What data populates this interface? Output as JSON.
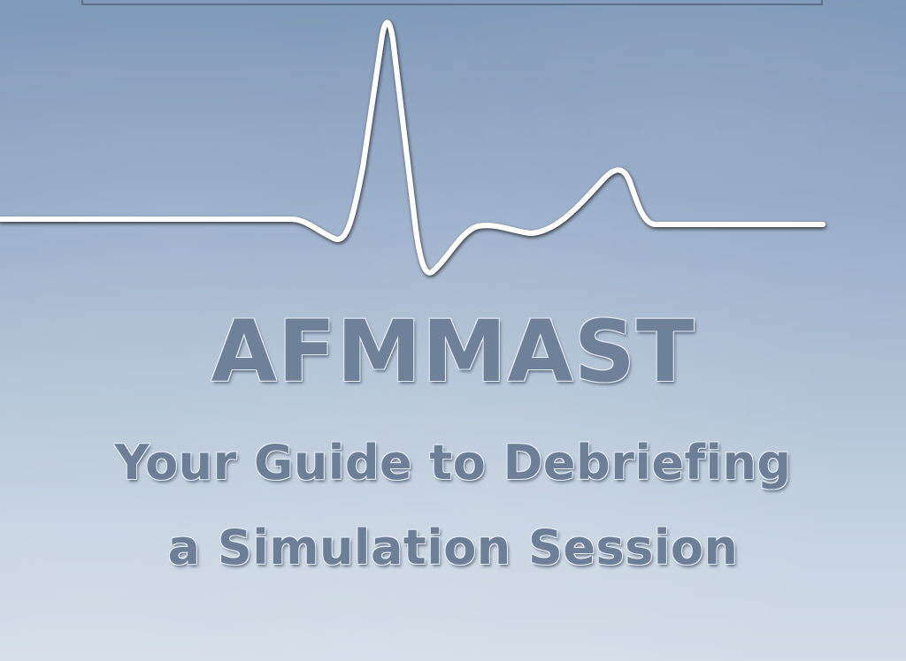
{
  "title": "AFMMAST",
  "subtitle_line1": "Your Guide to Debriefing",
  "subtitle_line2": "a Simulation Session",
  "colors": {
    "background_top": "#7f98b8",
    "background_bottom": "#d3dde8",
    "title_text": "#6f8198",
    "ecg_line": "#ffffff"
  },
  "graphics": {
    "waveform": "ecg-heartbeat-line"
  }
}
